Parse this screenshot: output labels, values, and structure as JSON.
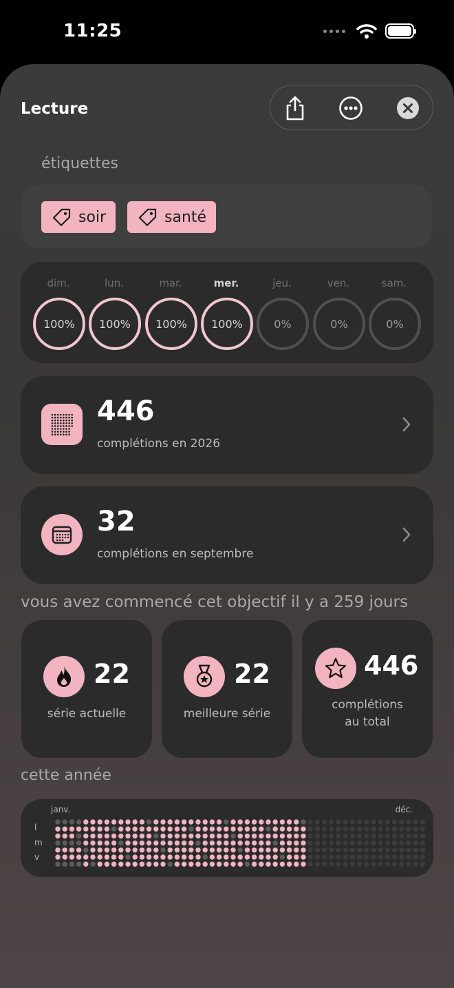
{
  "status_bar": {
    "time": "11:25"
  },
  "header": {
    "title": "Lecture"
  },
  "tags_section": {
    "label": "étiquettes",
    "tags": [
      {
        "label": "soir"
      },
      {
        "label": "santé"
      }
    ]
  },
  "week": {
    "days": [
      {
        "label": "dim.",
        "value": "100%",
        "done": true,
        "today": false
      },
      {
        "label": "lun.",
        "value": "100%",
        "done": true,
        "today": false
      },
      {
        "label": "mar.",
        "value": "100%",
        "done": true,
        "today": false
      },
      {
        "label": "mer.",
        "value": "100%",
        "done": true,
        "today": true
      },
      {
        "label": "jeu.",
        "value": "0%",
        "done": false,
        "today": false
      },
      {
        "label": "ven.",
        "value": "0%",
        "done": false,
        "today": false
      },
      {
        "label": "sam.",
        "value": "0%",
        "done": false,
        "today": false
      }
    ]
  },
  "yearly_stat": {
    "number": "446",
    "label": "complétions en 2026"
  },
  "monthly_stat": {
    "number": "32",
    "label": "complétions en septembre"
  },
  "since_text": "vous avez commencé cet objectif il y a 259 jours",
  "mini_stats": [
    {
      "number": "22",
      "label": "série actuelle",
      "icon": "flame-icon"
    },
    {
      "number": "22",
      "label": "meilleure série",
      "icon": "medal-icon"
    },
    {
      "number": "446",
      "label": "complétions",
      "label2": "au total",
      "icon": "star-icon"
    }
  ],
  "year_section": {
    "label": "cette année",
    "month_start": "janv.",
    "month_end": "déc.",
    "weekday_labels": [
      "l",
      "m",
      "v"
    ]
  },
  "colors": {
    "accent": "#f2b4c0",
    "card": "#2b2b2b",
    "dot_done": "#f0b3bf",
    "dot_missed": "#5c5c5c",
    "dot_future": "#3b3b3b"
  }
}
